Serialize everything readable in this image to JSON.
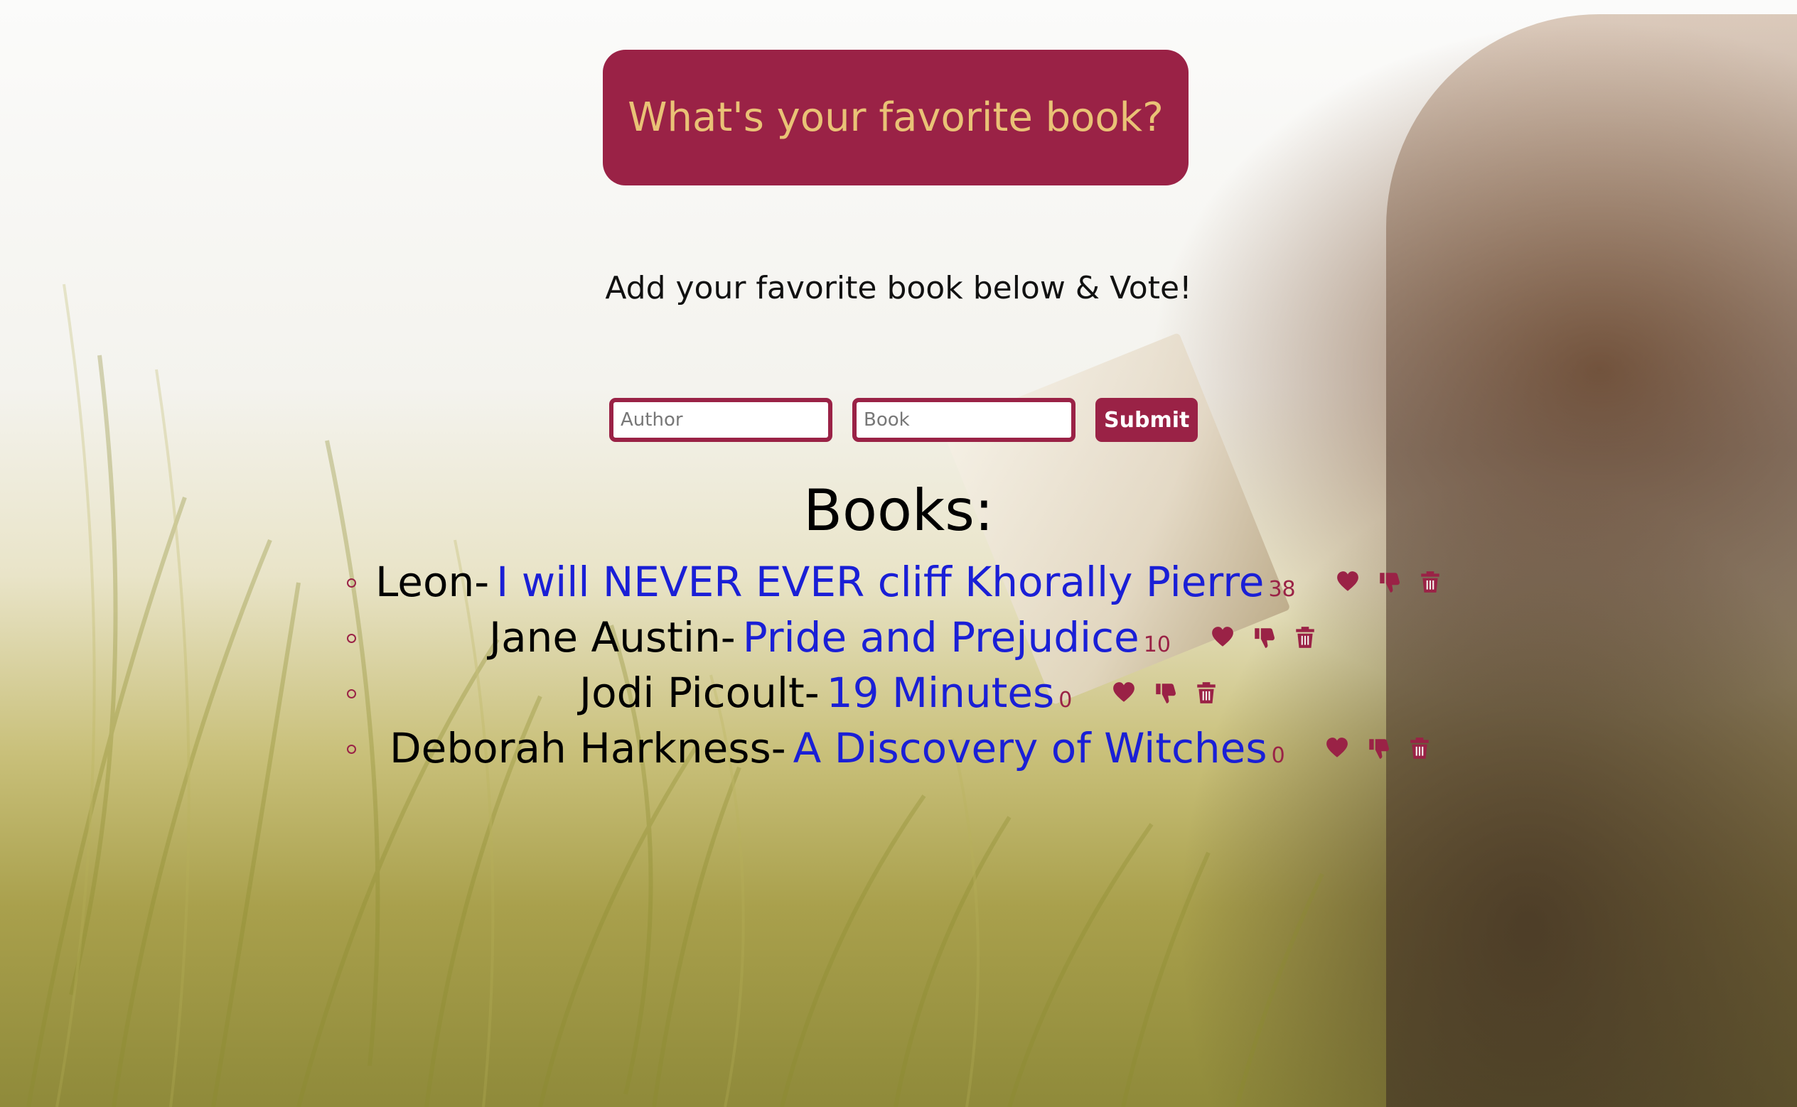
{
  "header": {
    "title": "What's your favorite book?"
  },
  "subtitle": "Add your favorite book below & Vote!",
  "form": {
    "author_placeholder": "Author",
    "book_placeholder": "Book",
    "submit_label": "Submit"
  },
  "books_heading": "Books:",
  "books": [
    {
      "author": "Leon-",
      "title": "I will NEVER EVER cliff Khorally Pierre",
      "votes": "38"
    },
    {
      "author": "Jane Austin-",
      "title": "Pride and Prejudice",
      "votes": "10"
    },
    {
      "author": "Jodi Picoult-",
      "title": "19 Minutes",
      "votes": "0"
    },
    {
      "author": "Deborah Harkness-",
      "title": "A Discovery of Witches",
      "votes": "0"
    }
  ],
  "icons": {
    "like": "heart-icon",
    "dislike": "thumbs-down-icon",
    "delete": "trash-icon"
  },
  "colors": {
    "accent": "#9a2246",
    "header_text": "#e9c276",
    "book_title": "#1a1fd6"
  }
}
